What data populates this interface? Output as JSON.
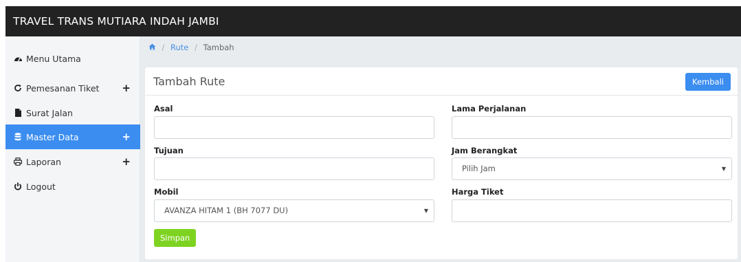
{
  "app": {
    "title": "TRAVEL TRANS MUTIARA INDAH JAMBI"
  },
  "sidebar": {
    "items": [
      {
        "label": "Menu Utama",
        "icon": "dashboard-icon"
      },
      {
        "label": "Pemesanan Tiket",
        "icon": "refresh-icon",
        "expandable": true
      },
      {
        "label": "Surat Jalan",
        "icon": "file-icon"
      },
      {
        "label": "Master Data",
        "icon": "database-icon",
        "expandable": true,
        "active": true
      },
      {
        "label": "Laporan",
        "icon": "print-icon",
        "expandable": true
      },
      {
        "label": "Logout",
        "icon": "power-icon"
      }
    ],
    "expand_symbol": "+"
  },
  "breadcrumb": {
    "home_icon": "home-icon",
    "separator": "/",
    "link": "Rute",
    "current": "Tambah"
  },
  "form": {
    "title": "Tambah Rute",
    "back_label": "Kembali",
    "fields": {
      "asal": {
        "label": "Asal",
        "value": ""
      },
      "tujuan": {
        "label": "Tujuan",
        "value": ""
      },
      "mobil": {
        "label": "Mobil",
        "selected": "AVANZA HITAM 1 (BH 7077 DU)"
      },
      "lama": {
        "label": "Lama Perjalanan",
        "value": ""
      },
      "jam": {
        "label": "Jam Berangkat",
        "selected": "Pilih Jam"
      },
      "harga": {
        "label": "Harga Tiket",
        "value": ""
      }
    },
    "submit_label": "Simpan"
  },
  "colors": {
    "topbar": "#222222",
    "accent": "#3b8df0",
    "success": "#7ed321",
    "content_bg": "#e9ecef"
  }
}
